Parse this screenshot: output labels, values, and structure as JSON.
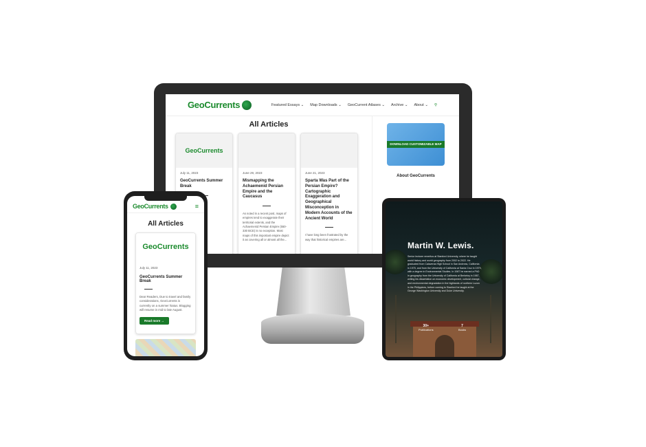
{
  "desktop": {
    "logo": "GeoCurrents",
    "nav": [
      "Featured Essays ⌄",
      "Map Downloads ⌄",
      "GeoCurrent Atlases ⌄",
      "Archive ⌄",
      "About ⌄"
    ],
    "page_title": "All Articles",
    "cards": [
      {
        "thumb_logo": "GeoCurrents",
        "date": "July 11, 2023",
        "title": "GeoCurrents Summer Break",
        "excerpt": ""
      },
      {
        "date": "June 29, 2023",
        "title": "Mismapping the Achaemenid Persian Empire and the Caucasus",
        "excerpt": "As noted in a recent post, maps of empires tend to exaggerate their territorial extents, and the Achaemenid Persian Empire (550-330 BCE) is no exception. Most maps of this important empire depict it as covering all or almost all the..."
      },
      {
        "date": "June 21, 2023",
        "title": "Sparta Was Part of the Persian Empire? Cartographic Exaggeration and Geographical Misconception in Modern Accounts of the Ancient World",
        "excerpt": "I have long been frustrated by the way that historical empires are..."
      }
    ],
    "sidebar": {
      "download_badge": "DOWNLOAD CUSTOMIZABLE MAP",
      "about_title": "About GeoCurrents"
    }
  },
  "phone": {
    "logo": "GeoCurrents",
    "menu_icon": "≡",
    "page_title": "All Articles",
    "card": {
      "thumb_logo": "GeoCurrents",
      "date": "July 11, 2023",
      "title": "GeoCurrents Summer Break",
      "excerpt": "Dear Readers, Due to travel and family considerations, GeoCurrents is currently on a summer hiatus. Blogging will resume in mid to late August.",
      "button": "Read more →"
    }
  },
  "tablet": {
    "name": "Martin W. Lewis.",
    "bio": "Senior lecturer emeritus at Stanford University, where he taught world history and world geography from 2002 to 2022. He graduated from Calaveras High School in San Andreas, California in 1975, and from the University of California at Santa Cruz in 1979, with a degree in Environmental Studies. In 1987 he earned a PhD in geography from the University of California at Berkeley in 1987, writing his dissertation on economic development, cultural change, and environmental degradation in the highlands of northern Luzon in the Philippines, before coming to Stanford he taught at the George Washington University and Duke University.",
    "stats": [
      {
        "value": "30+",
        "label": "Publications"
      },
      {
        "value": "7",
        "label": "Books"
      }
    ]
  }
}
